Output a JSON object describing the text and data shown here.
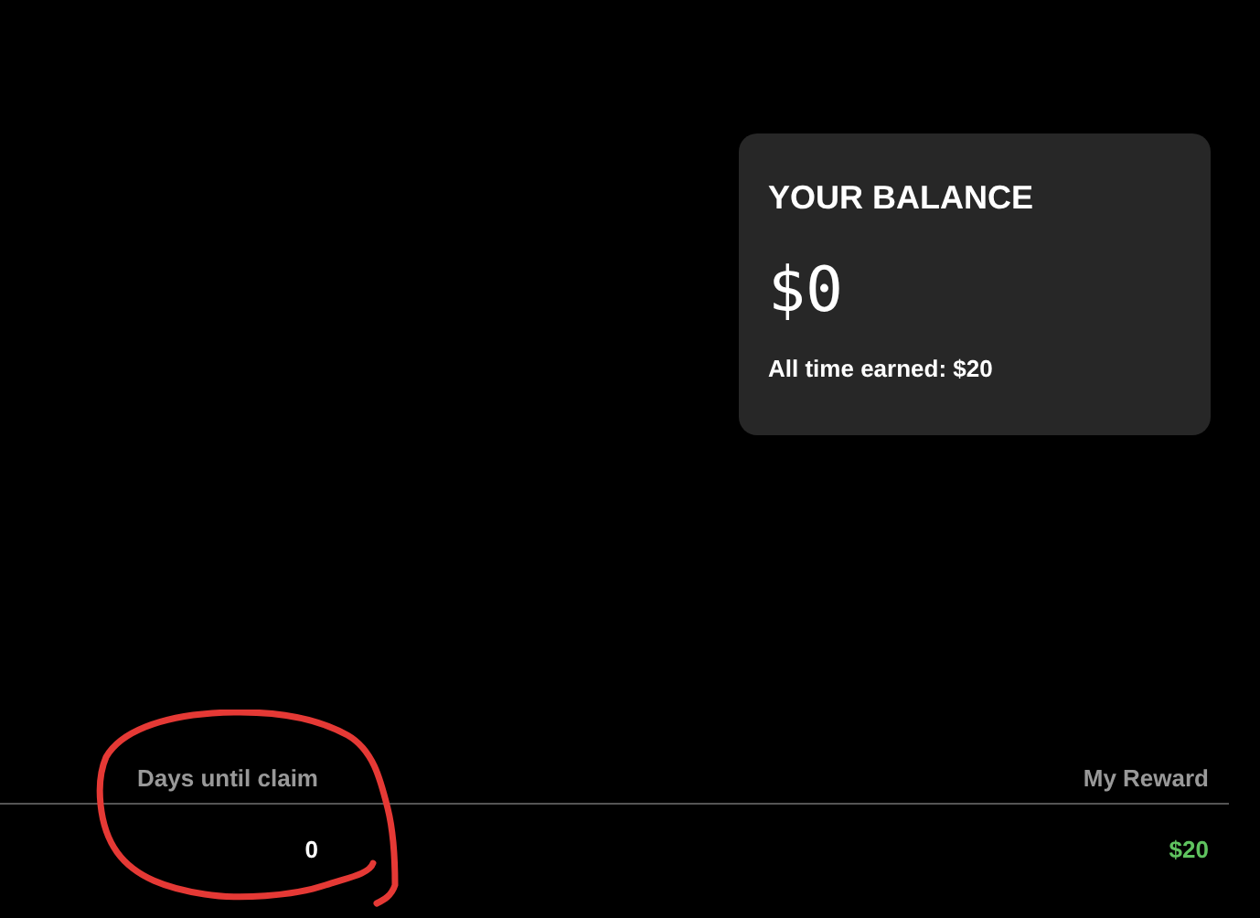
{
  "balance_card": {
    "title": "YOUR BALANCE",
    "amount": "$0",
    "all_time": "All time earned: $20"
  },
  "table": {
    "columns": [
      "Days until claim",
      "My Reward"
    ],
    "rows": [
      {
        "cells": [
          "0",
          "$20"
        ]
      }
    ]
  },
  "annotation": {
    "kind": "circle",
    "color": "#e53935"
  }
}
